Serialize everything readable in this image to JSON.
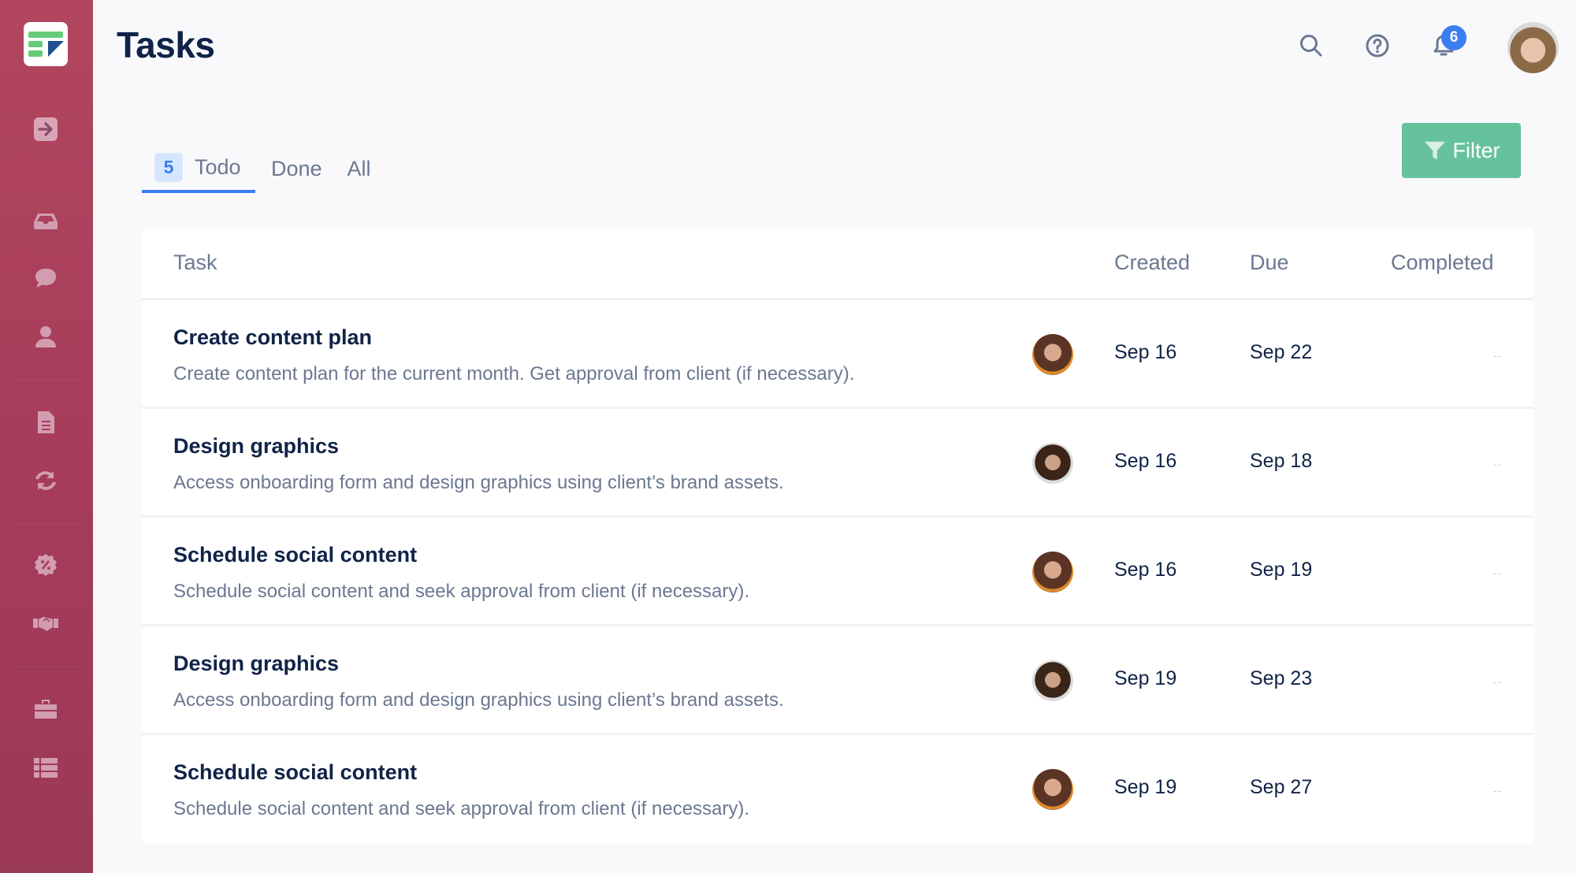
{
  "app": {
    "title": "Tasks",
    "brand_colors": {
      "sidebar": "#a9405b",
      "accent": "#3b7ef0",
      "filter": "#66c29d",
      "logo_green": "#66cc77",
      "logo_blue": "#1f4f8c"
    }
  },
  "sidebar": {
    "items": [
      {
        "icon": "arrow-right-icon",
        "name": "expand"
      },
      {
        "icon": "inbox-icon",
        "name": "inbox"
      },
      {
        "icon": "chat-icon",
        "name": "messages"
      },
      {
        "icon": "user-icon",
        "name": "contacts"
      },
      {
        "icon": "document-icon",
        "name": "documents"
      },
      {
        "icon": "sync-icon",
        "name": "recurring"
      },
      {
        "icon": "discount-icon",
        "name": "discounts"
      },
      {
        "icon": "handshake-icon",
        "name": "deals"
      },
      {
        "icon": "toolbox-icon",
        "name": "tools"
      },
      {
        "icon": "list-icon",
        "name": "lists"
      }
    ]
  },
  "header": {
    "notifications_count": "6",
    "icons": [
      "search-icon",
      "help-icon",
      "bell-icon"
    ]
  },
  "tabs": [
    {
      "label": "Todo",
      "count": "5",
      "active": true
    },
    {
      "label": "Done",
      "active": false
    },
    {
      "label": "All",
      "active": false
    }
  ],
  "filter": {
    "label": "Filter"
  },
  "table": {
    "columns": {
      "task": "Task",
      "created": "Created",
      "due": "Due",
      "completed": "Completed"
    },
    "rows": [
      {
        "title": "Create content plan",
        "description": "Create content plan for the current month. Get approval from client (if necessary).",
        "assignee": "female",
        "created": "Sep 16",
        "due": "Sep 22",
        "completed": "--"
      },
      {
        "title": "Design graphics",
        "description": "Access onboarding form and design graphics using client’s brand assets.",
        "assignee": "male",
        "created": "Sep 16",
        "due": "Sep 18",
        "completed": "--"
      },
      {
        "title": "Schedule social content",
        "description": "Schedule social content and seek approval from client (if necessary).",
        "assignee": "female",
        "created": "Sep 16",
        "due": "Sep 19",
        "completed": "--"
      },
      {
        "title": "Design graphics",
        "description": "Access onboarding form and design graphics using client’s brand assets.",
        "assignee": "male",
        "created": "Sep 19",
        "due": "Sep 23",
        "completed": "--"
      },
      {
        "title": "Schedule social content",
        "description": "Schedule social content and seek approval from client (if necessary).",
        "assignee": "female",
        "created": "Sep 19",
        "due": "Sep 27",
        "completed": "--"
      }
    ]
  }
}
